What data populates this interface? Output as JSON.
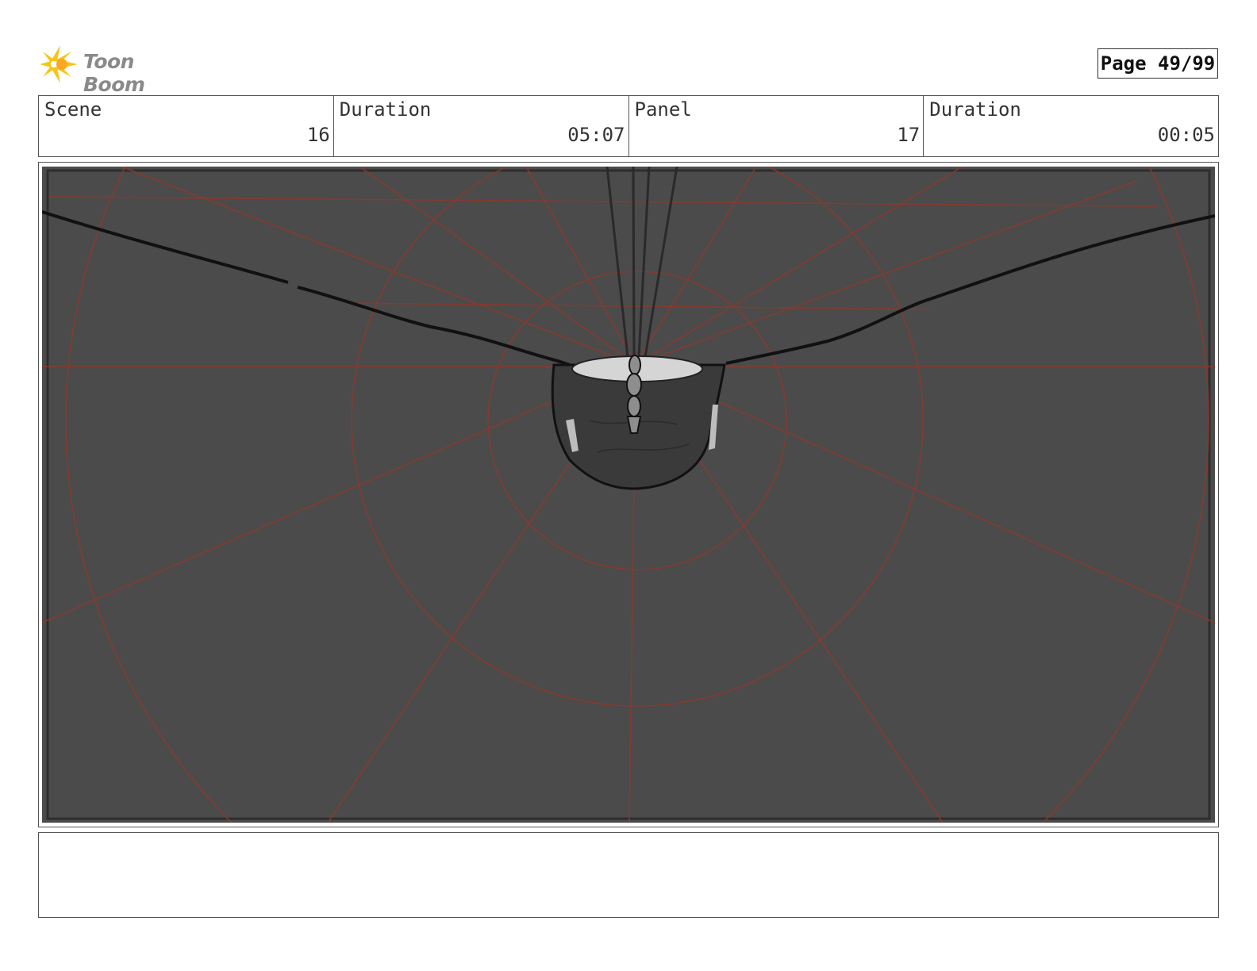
{
  "header": {
    "logo_text": "Toon Boom",
    "page_label": "Page 49/99"
  },
  "info": {
    "scene_label": "Scene",
    "scene_value": "16",
    "scene_duration_label": "Duration",
    "scene_duration_value": "05:07",
    "panel_label": "Panel",
    "panel_value": "17",
    "panel_duration_label": "Duration",
    "panel_duration_value": "00:05"
  },
  "colors": {
    "panel_background": "#4b4b4b",
    "perspective_guides": "#8b3a2e",
    "logo_accent": "#f5c518"
  },
  "notes": {
    "text": ""
  }
}
